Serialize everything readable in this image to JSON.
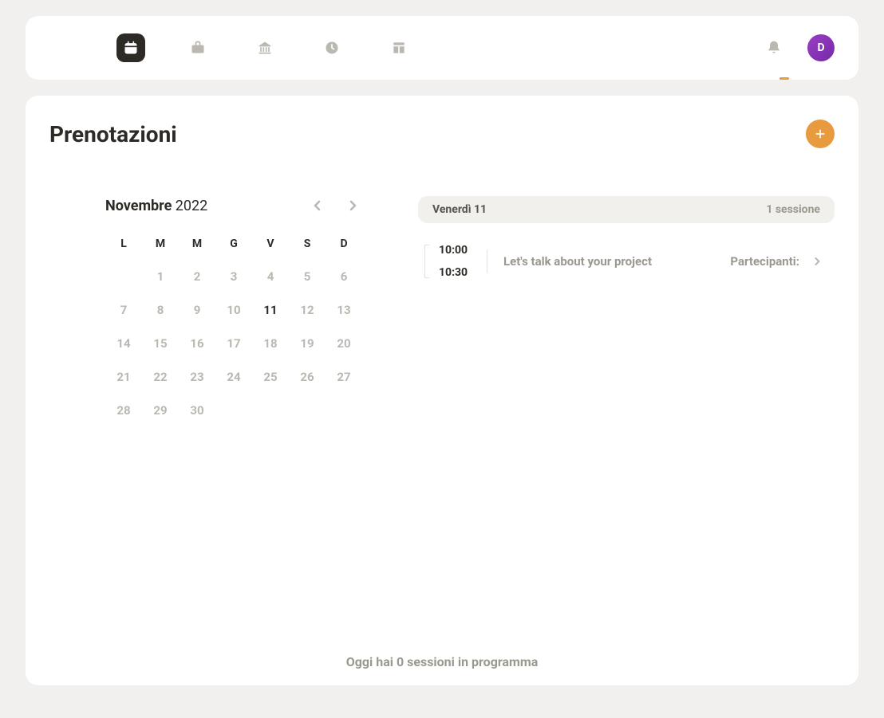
{
  "header": {
    "avatar_initial": "D"
  },
  "page": {
    "title": "Prenotazioni"
  },
  "calendar": {
    "month": "Novembre",
    "year": "2022",
    "weekdays": [
      "L",
      "M",
      "M",
      "G",
      "V",
      "S",
      "D"
    ],
    "days": [
      "",
      "1",
      "2",
      "3",
      "4",
      "5",
      "6",
      "7",
      "8",
      "9",
      "10",
      "11",
      "12",
      "13",
      "14",
      "15",
      "16",
      "17",
      "18",
      "19",
      "20",
      "21",
      "22",
      "23",
      "24",
      "25",
      "26",
      "27",
      "28",
      "29",
      "30"
    ],
    "selected": "11"
  },
  "sessions": {
    "date_label": "Venerdì 11",
    "count_label": "1 sessione",
    "items": [
      {
        "start": "10:00",
        "end": "10:30",
        "title": "Let's talk about your project",
        "participants_label": "Partecipanti:"
      }
    ]
  },
  "footer": {
    "text": "Oggi hai 0 sessioni in programma"
  }
}
